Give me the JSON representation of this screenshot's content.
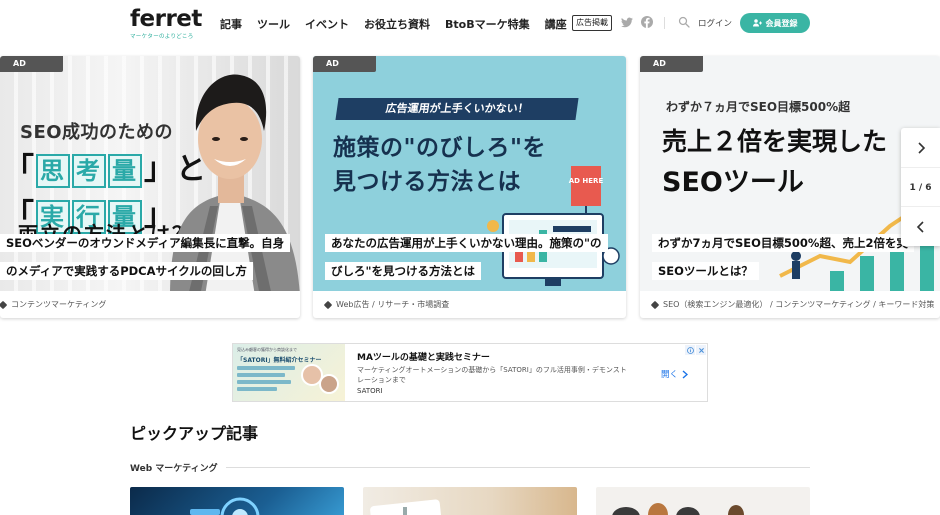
{
  "header": {
    "logo": "ferret",
    "logo_tagline": "マーケターのよりどころ",
    "nav": [
      "記事",
      "ツール",
      "イベント",
      "お役立ち資料",
      "BtoBマーケ特集",
      "講座"
    ],
    "ad_listing": "広告掲載",
    "login": "ログイン",
    "register": "会員登録"
  },
  "slider": {
    "counter": "1 / 6",
    "cards": [
      {
        "ad_label": "AD",
        "image_text": {
          "line1": "SEO成功のための",
          "chars_a": [
            "思",
            "考",
            "量"
          ],
          "chars_b": [
            "実",
            "行",
            "量"
          ],
          "line4": "両立の方法とは？"
        },
        "title_lines": [
          "SEOベンダーのオウンドメディア編集長に直撃。自身",
          "のメディアで実践するPDCAサイクルの回し方"
        ],
        "category": "コンテンツマーケティング"
      },
      {
        "ad_label": "AD",
        "image_text": {
          "banner": "広告運用が上手くいかない！",
          "line1": "施策の\"のびしろ\"を",
          "line2": "見つける方法とは",
          "sign": "AD HERE"
        },
        "title_lines": [
          "あなたの広告運用が上手くいかない理由。施策の\"の",
          "びしろ\"を見つける方法とは"
        ],
        "category": "Web広告 / リサーチ・市場調査"
      },
      {
        "ad_label": "AD",
        "image_text": {
          "sub": "わずか７ヵ月でSEO目標500%超",
          "line1": "売上２倍を実現した",
          "line2": "SEOツール"
        },
        "title_lines": [
          "わずか7ヵ月でSEO目標500%超、売上2倍を実",
          "SEOツールとは？"
        ],
        "category": "SEO（検索エンジン最適化） / コンテンツマーケティング / キーワード対策"
      }
    ]
  },
  "ad_banner": {
    "thumb_small": "見込み顧客の獲得から商談化まで",
    "thumb_title": "「SATORI」無料紹介セミナー",
    "title": "MAツールの基礎と実践セミナー",
    "description": "マーケティングオートメーションの基礎から「SATORI」のフル活用事例・デモンストレーションまで",
    "sponsor": "SATORI",
    "open_label": "開く"
  },
  "pickup": {
    "title": "ピックアップ記事",
    "section_label": "Web マーケティング"
  },
  "colors": {
    "accent": "#3ab5a4",
    "ad_tag": "#555555"
  }
}
